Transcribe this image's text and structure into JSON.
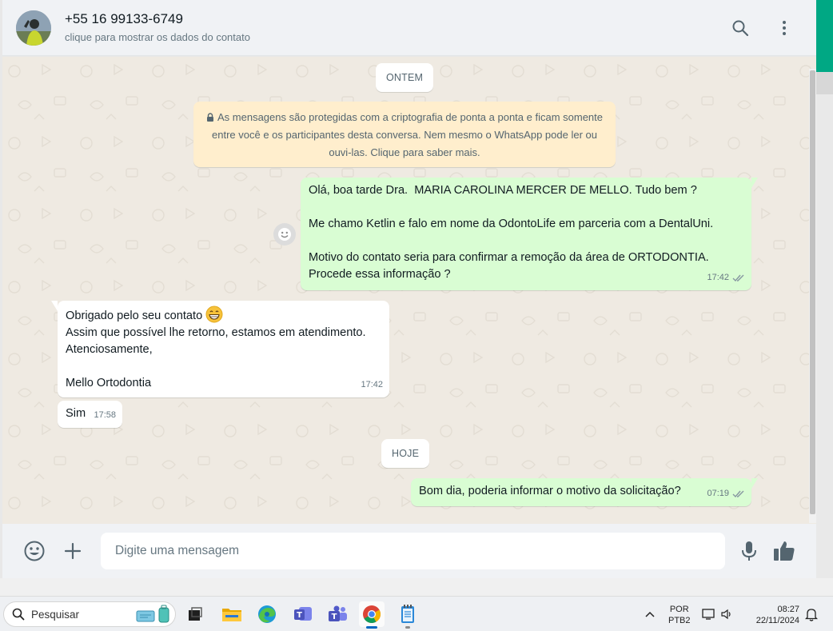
{
  "header": {
    "contact_name": "+55 16 99133-6749",
    "contact_subtitle": "clique para mostrar os dados do contato",
    "search_icon": "search-icon",
    "menu_icon": "kebab-menu-icon"
  },
  "chat": {
    "date_yesterday": "ONTEM",
    "date_today": "HOJE",
    "encryption_notice": "As mensagens são protegidas com a criptografia de ponta a ponta e ficam somente entre você e os participantes desta conversa. Nem mesmo o WhatsApp pode ler ou ouvi-las. Clique para saber mais.",
    "messages": [
      {
        "direction": "outgoing",
        "lines": [
          "Olá, boa tarde Dra.  MARIA CAROLINA MERCER DE MELLO. Tudo bem ?",
          "",
          "Me chamo Ketlin e falo em nome da OdontoLife em parceria com a DentalUni.",
          "",
          "Motivo do contato seria para confirmar a remoção da área de ORTODONTIA.",
          "Procede essa informação ?"
        ],
        "time": "17:42",
        "status": "read"
      },
      {
        "direction": "incoming",
        "lines": [
          "Obrigado pelo seu contato",
          "Assim que possível lhe retorno, estamos em atendimento.",
          "Atenciosamente,",
          "",
          "Mello Ortodontia"
        ],
        "emoji_icon": "grinning-face-emoji",
        "time": "17:42"
      },
      {
        "direction": "incoming",
        "lines": [
          "Sim"
        ],
        "time": "17:58"
      },
      {
        "direction": "outgoing",
        "lines": [
          "Bom dia, poderia informar o motivo da solicitação?"
        ],
        "time": "07:19",
        "status": "read"
      }
    ]
  },
  "composer": {
    "placeholder": "Digite uma mensagem"
  },
  "taskbar": {
    "search_label": "Pesquisar",
    "lang_top": "POR",
    "lang_bottom": "PTB2",
    "time": "08:27",
    "date": "22/11/2024"
  },
  "colors": {
    "outgoing_bubble": "#d9fdd3",
    "incoming_bubble": "#ffffff",
    "chat_background": "#efeae2",
    "encryption_background": "#ffeecd",
    "accent": "#00a884"
  }
}
